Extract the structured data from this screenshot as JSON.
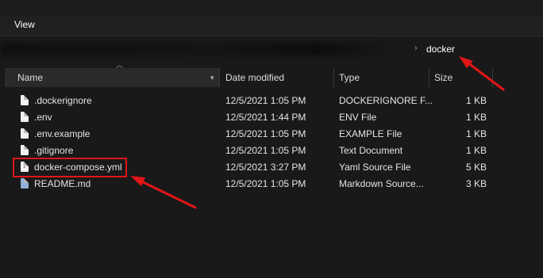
{
  "menu": {
    "view_label": "View"
  },
  "address": {
    "separator": "›",
    "current_folder": "docker"
  },
  "columns": {
    "name": "Name",
    "date_modified": "Date modified",
    "type": "Type",
    "size": "Size"
  },
  "files": [
    {
      "name": ".dockerignore",
      "date": "12/5/2021 1:05 PM",
      "type": "DOCKERIGNORE F...",
      "size": "1 KB",
      "icon": "file-icon"
    },
    {
      "name": ".env",
      "date": "12/5/2021 1:44 PM",
      "type": "ENV File",
      "size": "1 KB",
      "icon": "file-icon"
    },
    {
      "name": ".env.example",
      "date": "12/5/2021 1:05 PM",
      "type": "EXAMPLE File",
      "size": "1 KB",
      "icon": "file-icon"
    },
    {
      "name": ".gitignore",
      "date": "12/5/2021 1:05 PM",
      "type": "Text Document",
      "size": "1 KB",
      "icon": "file-icon"
    },
    {
      "name": "docker-compose.yml",
      "date": "12/5/2021 3:27 PM",
      "type": "Yaml Source File",
      "size": "5 KB",
      "icon": "yaml-file-icon"
    },
    {
      "name": "README.md",
      "date": "12/5/2021 1:05 PM",
      "type": "Markdown Source...",
      "size": "3 KB",
      "icon": "markdown-file-icon"
    }
  ],
  "annotation_color": "#e01515"
}
